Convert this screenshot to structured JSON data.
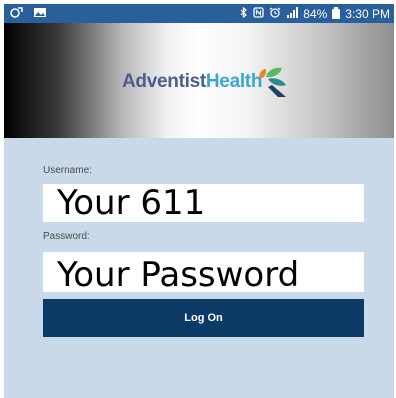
{
  "status_bar": {
    "time": "3:30 PM",
    "battery": "84%",
    "icons": [
      "notification-icon",
      "image-icon",
      "bluetooth-icon",
      "nfc-icon",
      "alarm-icon",
      "signal-icon",
      "battery-icon"
    ]
  },
  "header": {
    "logo_text_part1": "Adventist",
    "logo_text_part2": "Health",
    "logo_colors": {
      "adventist": "#4e5d8d",
      "health": "#3aa6d6",
      "leaf_green": "#5cb85c",
      "leaf_orange": "#e8862e",
      "leaf_teal": "#2b8a8f",
      "leaf_navy": "#1f3f66"
    }
  },
  "form": {
    "username_label": "Username:",
    "username_value": "Your 611",
    "password_label": "Password:",
    "password_value": "Your Password",
    "submit_label": "Log On"
  },
  "colors": {
    "status_bar_bg": "#2a5f9e",
    "form_bg": "#c9d9ea",
    "button_bg": "#0c3a66"
  }
}
